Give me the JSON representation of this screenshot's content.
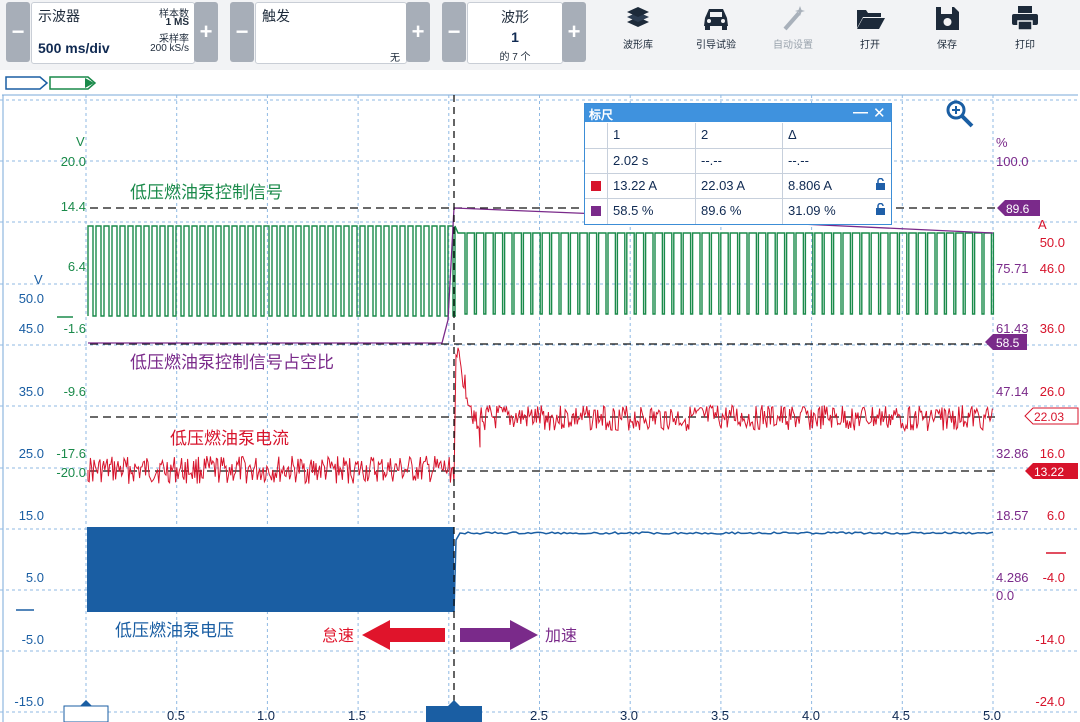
{
  "toolbar": {
    "scope": {
      "title": "示波器",
      "timebase": "500 ms/div",
      "samples_label": "样本数",
      "samples_value": "1 MS",
      "rate_label": "采样率",
      "rate_value": "200 kS/s"
    },
    "trigger": {
      "title": "触发",
      "value": "无"
    },
    "waveform": {
      "title": "波形",
      "index": "1",
      "of_label": "的 7 个"
    },
    "buttons": [
      {
        "label": "波形库",
        "icon": "library-icon",
        "enabled": true
      },
      {
        "label": "引导试验",
        "icon": "car-icon",
        "enabled": true
      },
      {
        "label": "自动设置",
        "icon": "magic-wand-icon",
        "enabled": false
      },
      {
        "label": "打开",
        "icon": "folder-open-icon",
        "enabled": true
      },
      {
        "label": "保存",
        "icon": "save-icon",
        "enabled": true
      },
      {
        "label": "打印",
        "icon": "printer-icon",
        "enabled": true
      }
    ],
    "minus": "−",
    "plus": "+"
  },
  "ruler": {
    "title": "标尺",
    "min_btn": "—",
    "close_btn": "✕",
    "headers": [
      "1",
      "2",
      "Δ"
    ],
    "rows": [
      {
        "color": "",
        "c1": "2.02 s",
        "c2": "--.--",
        "c3": "--.--",
        "lock": ""
      },
      {
        "color": "#d7132b",
        "c1": "13.22 A",
        "c2": "22.03 A",
        "c3": "8.806 A",
        "lock": "🔓"
      },
      {
        "color": "#7a2a8a",
        "c1": "58.5 %",
        "c2": "89.6 %",
        "c3": "31.09 %",
        "lock": "🔓"
      }
    ]
  },
  "axes": {
    "x_ticks": [
      "0.0 s",
      "0.5",
      "1.0",
      "1.5",
      "2.02 s",
      "2.5",
      "3.0",
      "3.5",
      "4.0",
      "4.5",
      "5.0"
    ],
    "green_unit": "V",
    "green_ticks": [
      "20.0",
      "14.4",
      "6.4",
      "-1.6",
      "-9.6",
      "-17.6",
      "-20.0"
    ],
    "blue_unit": "V",
    "blue_ticks": [
      "50.0",
      "45.0",
      "35.0",
      "25.0",
      "15.0",
      "5.0",
      "-5.0",
      "-15.0"
    ],
    "purple_unit": "%",
    "purple_ticks": [
      "100.0",
      "75.71",
      "61.43",
      "47.14",
      "32.86",
      "18.57",
      "4.286",
      "0.0"
    ],
    "red_unit": "A",
    "red_ticks": [
      "50.0",
      "46.0",
      "36.0",
      "26.0",
      "16.0",
      "6.0",
      "-4.0",
      "-14.0",
      "-24.0"
    ]
  },
  "labels": {
    "green": "低压燃油泵控制信号",
    "purple": "低压燃油泵控制信号占空比",
    "red": "低压燃油泵电流",
    "blue": "低压燃油泵电压",
    "decel": "怠速",
    "accel": "加速"
  },
  "markers": {
    "m896": "89.6",
    "m585": "58.5",
    "m2203": "22.03",
    "m1322": "13.22"
  },
  "colors": {
    "green": "#1a8a4a",
    "purple": "#7a2a8a",
    "red": "#d7132b",
    "blue": "#1a5ea3",
    "grid": "#8fb9e3",
    "accent": "#3f92de"
  }
}
